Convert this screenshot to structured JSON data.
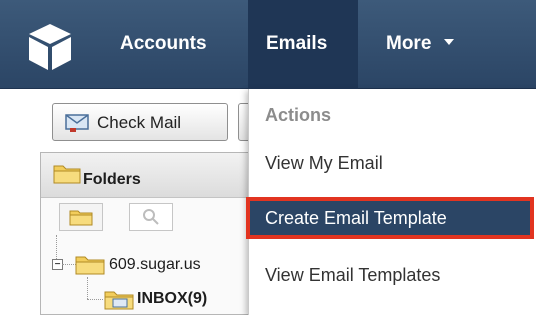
{
  "nav": {
    "accounts_label": "Accounts",
    "emails_label": "Emails",
    "more_label": "More"
  },
  "toolbar": {
    "check_mail_label": "Check Mail"
  },
  "folders": {
    "title": "Folders",
    "account_label": "609.sugar.us",
    "inbox_label": "INBOX(9)"
  },
  "dropdown": {
    "heading": "Actions",
    "items": [
      {
        "label": "View My Email"
      },
      {
        "label": "Create Email Template",
        "highlighted": true
      },
      {
        "label": "View Email Templates"
      }
    ]
  },
  "colors": {
    "navbar": "#2b4565",
    "navbar_active": "#1f3655",
    "highlight_border": "#e23420",
    "heading_gray": "#8c8c8c"
  },
  "icons": [
    "cube-logo-icon",
    "mail-icon",
    "folder-icon",
    "search-icon",
    "inbox-folder-icon",
    "caret-down-icon"
  ]
}
